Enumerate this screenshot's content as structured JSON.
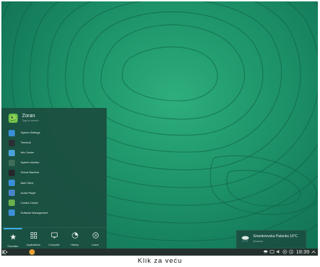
{
  "user": {
    "name": "Zoran",
    "search_placeholder": "Type to search..."
  },
  "menu_items": [
    {
      "label": "System Settings",
      "icon": "settings-icon",
      "color": "#3a8fd6"
    },
    {
      "label": "Terminal",
      "icon": "terminal-icon",
      "color": "#2b2f33"
    },
    {
      "label": "Info Center",
      "icon": "info-center-icon",
      "color": "#4aa0d8"
    },
    {
      "label": "System Monitor",
      "icon": "system-monitor-icon",
      "color": "#3e6e5a"
    },
    {
      "label": "Virtual Machine",
      "icon": "virtual-machine-icon",
      "color": "#23272a"
    },
    {
      "label": "Mail Client",
      "icon": "mail-icon",
      "color": "#3a8fd6"
    },
    {
      "label": "Audio Player",
      "icon": "audio-player-icon",
      "color": "#4a84c8"
    },
    {
      "label": "Control Center",
      "icon": "control-center-icon",
      "color": "#6ab04c"
    },
    {
      "label": "Software Management",
      "icon": "software-management-icon",
      "color": "#3d8fd8"
    }
  ],
  "tabs": [
    {
      "label": "Favorites",
      "icon": "star-icon"
    },
    {
      "label": "Applications",
      "icon": "grid-icon"
    },
    {
      "label": "Computer",
      "icon": "monitor-icon"
    },
    {
      "label": "History",
      "icon": "clock-icon"
    },
    {
      "label": "Leave",
      "icon": "leave-icon"
    }
  ],
  "weather": {
    "location": "Smederevska Palanka 16°C",
    "condition": "Showers"
  },
  "taskbar": {
    "time": "18:39"
  },
  "caption": "Klik za veću"
}
